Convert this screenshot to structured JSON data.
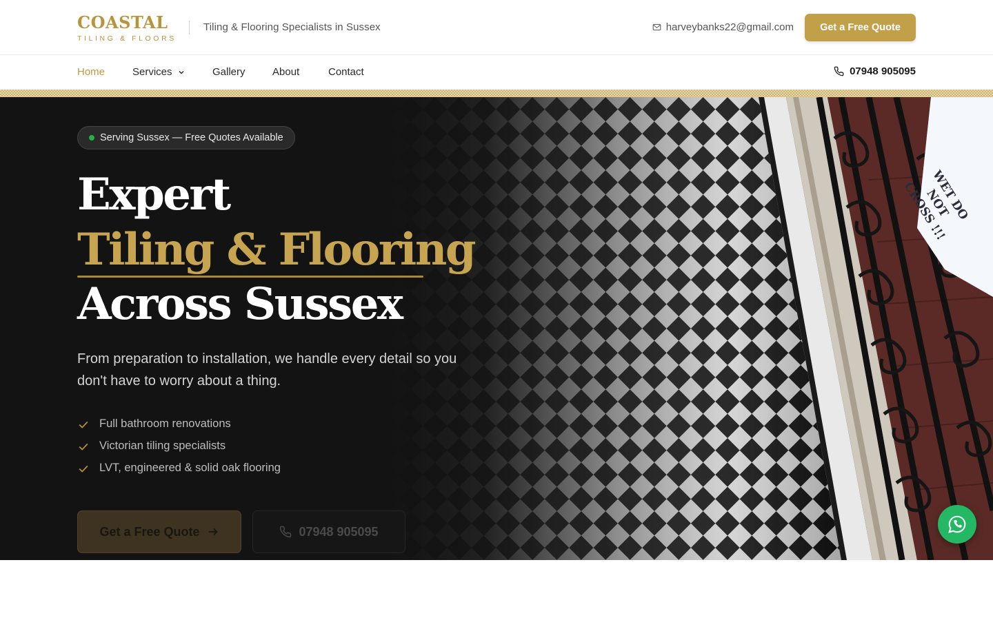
{
  "brand": {
    "name": "COASTAL",
    "sub": "TILING & FLOORS"
  },
  "header": {
    "tagline": "Tiling & Flooring Specialists in Sussex",
    "email": "harveybanks22@gmail.com",
    "cta_label": "Get a Free Quote"
  },
  "nav": {
    "items": [
      {
        "label": "Home",
        "active": true
      },
      {
        "label": "Services",
        "dropdown": true
      },
      {
        "label": "Gallery"
      },
      {
        "label": "About"
      },
      {
        "label": "Contact"
      }
    ],
    "phone": "07948 905095"
  },
  "hero": {
    "badge": "Serving Sussex — Free Quotes Available",
    "heading_line1": "Expert",
    "heading_line2": "Tiling & Flooring",
    "heading_line3": "Across Sussex",
    "lead": "From preparation to installation, we handle every detail so you don't have to worry about a thing.",
    "features": [
      "Full bathroom renovations",
      "Victorian tiling specialists",
      "LVT, engineered & solid oak flooring"
    ],
    "cta_quote": "Get a Free Quote",
    "cta_phone": "07948 905095",
    "sign_text": "WET DO NOT CROSS !!!"
  },
  "colors": {
    "accent": "#c2a04a",
    "hero_bg": "#131313",
    "whatsapp": "#25b864",
    "status_dot": "#22b14c"
  },
  "icons": [
    "mail-icon",
    "chevron-down-icon",
    "phone-icon",
    "check-icon",
    "arrow-right-icon",
    "whatsapp-icon"
  ]
}
